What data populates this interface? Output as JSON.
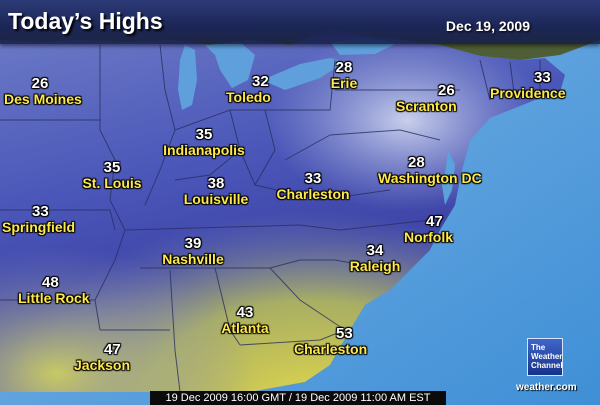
{
  "header": {
    "title": "Today’s Highs",
    "date": "Dec 19, 2009"
  },
  "cities": [
    {
      "id": "des-moines",
      "temp": "26",
      "name": "Des Moines"
    },
    {
      "id": "toledo",
      "temp": "32",
      "name": "Toledo"
    },
    {
      "id": "erie",
      "temp": "28",
      "name": "Erie"
    },
    {
      "id": "scranton",
      "temp": "26",
      "name": "Scranton"
    },
    {
      "id": "providence",
      "temp": "33",
      "name": "Providence"
    },
    {
      "id": "indianapolis",
      "temp": "35",
      "name": "Indianapolis"
    },
    {
      "id": "st-louis",
      "temp": "35",
      "name": "St. Louis"
    },
    {
      "id": "louisville",
      "temp": "38",
      "name": "Louisville"
    },
    {
      "id": "charleston-wv",
      "temp": "33",
      "name": "Charleston"
    },
    {
      "id": "washington-dc",
      "temp": "28",
      "name": "Washington DC"
    },
    {
      "id": "springfield",
      "temp": "33",
      "name": "Springfield"
    },
    {
      "id": "norfolk",
      "temp": "47",
      "name": "Norfolk"
    },
    {
      "id": "nashville",
      "temp": "39",
      "name": "Nashville"
    },
    {
      "id": "raleigh",
      "temp": "34",
      "name": "Raleigh"
    },
    {
      "id": "little-rock",
      "temp": "48",
      "name": "Little Rock"
    },
    {
      "id": "atlanta",
      "temp": "43",
      "name": "Atlanta"
    },
    {
      "id": "charleston-sc",
      "temp": "53",
      "name": "Charleston"
    },
    {
      "id": "jackson",
      "temp": "47",
      "name": "Jackson"
    }
  ],
  "logo": {
    "line1": "The",
    "line2": "Weather",
    "line3": "Channel",
    "url": "weather.com"
  },
  "footer": {
    "timestamp": "19 Dec 2009 16:00 GMT / 19 Dec 2009 11:00 AM EST"
  },
  "colors": {
    "ocean": "#5aa2dc",
    "cold": "#3e4ab2",
    "mild": "#8f9ac8",
    "warm": "#c9c84a",
    "label": "#ffe94a"
  }
}
